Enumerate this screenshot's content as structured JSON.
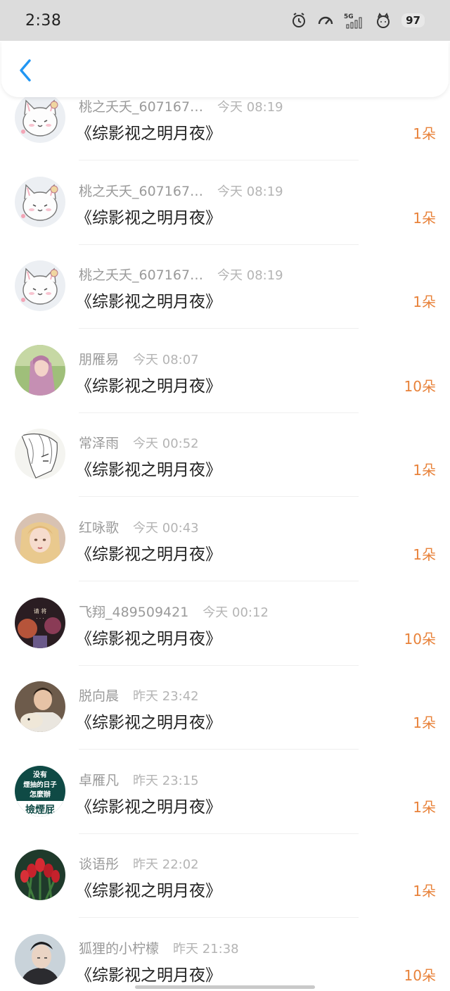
{
  "status_bar": {
    "time": "2:38",
    "network": "5G",
    "battery": "97"
  },
  "header": {
    "back_icon": "chevron-left-icon"
  },
  "accent_color": "#e8823a",
  "items": [
    {
      "name": "桃之夭夭_607167…",
      "time": "今天 08:19",
      "book": "《综影视之明月夜》",
      "amount": "1朵",
      "avatar": "cat"
    },
    {
      "name": "桃之夭夭_607167…",
      "time": "今天 08:19",
      "book": "《综影视之明月夜》",
      "amount": "1朵",
      "avatar": "cat"
    },
    {
      "name": "桃之夭夭_607167…",
      "time": "今天 08:19",
      "book": "《综影视之明月夜》",
      "amount": "1朵",
      "avatar": "cat"
    },
    {
      "name": "朋雁易",
      "time": "今天 08:07",
      "book": "《综影视之明月夜》",
      "amount": "10朵",
      "avatar": "pink-hair-girl"
    },
    {
      "name": "常泽雨",
      "time": "今天 00:52",
      "book": "《综影视之明月夜》",
      "amount": "1朵",
      "avatar": "sketch"
    },
    {
      "name": "红咏歌",
      "time": "今天 00:43",
      "book": "《综影视之明月夜》",
      "amount": "1朵",
      "avatar": "blonde-girl"
    },
    {
      "name": "飞翔_489509421",
      "time": "今天 00:12",
      "book": "《综影视之明月夜》",
      "amount": "10朵",
      "avatar": "dark-poster"
    },
    {
      "name": "脱向晨",
      "time": "昨天 23:42",
      "book": "《综影视之明月夜》",
      "amount": "1朵",
      "avatar": "boy-dog"
    },
    {
      "name": "卓雁凡",
      "time": "昨天 23:15",
      "book": "《综影视之明月夜》",
      "amount": "1朵",
      "avatar": "text-badge",
      "avatar_text": [
        "没有",
        "煙抽的日子",
        "怎麼辦",
        "撿煙屁"
      ]
    },
    {
      "name": "谈语彤",
      "time": "昨天 22:02",
      "book": "《综影视之明月夜》",
      "amount": "1朵",
      "avatar": "tulips"
    },
    {
      "name": "狐狸的小柠檬",
      "time": "昨天 21:38",
      "book": "《综影视之明月夜》",
      "amount": "10朵",
      "avatar": "man-portrait"
    }
  ]
}
